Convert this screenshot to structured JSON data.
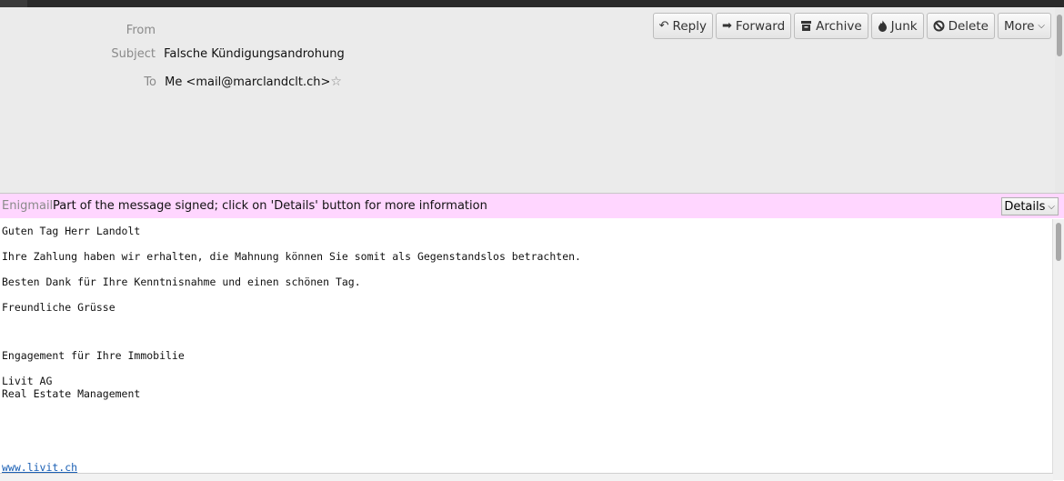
{
  "header": {
    "from_label": "From",
    "from_value": "",
    "subject_label": "Subject",
    "subject_value": "Falsche Kündigungsandrohung",
    "to_label": "To",
    "to_value": "Me <mail@marclandclt.ch>"
  },
  "toolbar": {
    "reply": "Reply",
    "forward": "Forward",
    "archive": "Archive",
    "junk": "Junk",
    "delete": "Delete",
    "more": "More"
  },
  "enigmail": {
    "label": "Enigmail",
    "message": "Part of the message signed; click on 'Details' button for more information",
    "details_button": "Details"
  },
  "body": {
    "lines": [
      "Guten Tag Herr Landolt",
      "Ihre Zahlung haben wir erhalten, die Mahnung können Sie somit als Gegenstandslos betrachten.",
      "Besten Dank für Ihre Kenntnisnahme und einen schönen Tag.",
      "Freundliche Grüsse",
      "Engagement für Ihre Immobilie",
      "Livit AG",
      "Real Estate Management"
    ],
    "link": "www.livit.ch"
  }
}
